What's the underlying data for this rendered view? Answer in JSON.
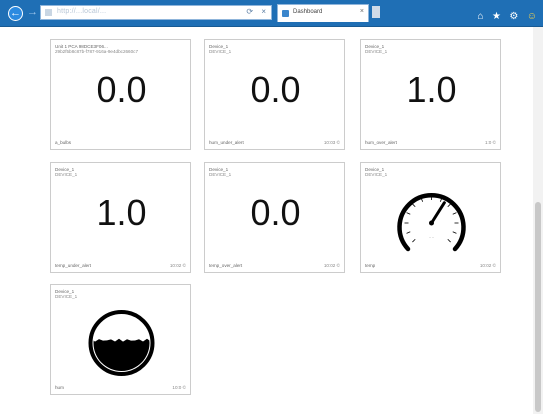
{
  "browser": {
    "url": "http://...local/...",
    "tab_label": "Dashboard",
    "tab_close": "×",
    "back": "←",
    "forward": "→",
    "tools": [
      "⌂",
      "★",
      "⚙",
      "☺"
    ]
  },
  "tiles": [
    {
      "title": "Unit 1 PCA 98DCE3F06...",
      "subtitle": "29b2f5b8c87b-f787-916a-9e4dbc2660c7",
      "value": "0.0",
      "footer": "a_bulbs",
      "time": ""
    },
    {
      "title": "Device_1",
      "subtitle": "DEVICE_1",
      "value": "0.0",
      "footer": "hum_under_alert",
      "time": "10:03 ©"
    },
    {
      "title": "Device_1",
      "subtitle": "DEVICE_1",
      "value": "1.0",
      "footer": "hum_over_alert",
      "time": "1:0 ©"
    },
    {
      "title": "Device_1",
      "subtitle": "DEVICE_1",
      "value": "1.0",
      "footer": "temp_under_alert",
      "time": "10:02 ©"
    },
    {
      "title": "Device_1",
      "subtitle": "DEVICE_1",
      "value": "0.0",
      "footer": "temp_over_alert",
      "time": "10:02 ©"
    },
    {
      "title": "Device_1",
      "subtitle": "DEVICE_1",
      "value": "",
      "footer": "temp",
      "time": "10:02 ©",
      "gauge_fraction": 0.62
    },
    {
      "title": "Device_1",
      "subtitle": "DEVICE_1",
      "value": "",
      "footer": "hum",
      "time": "10:0 ©",
      "tank_fraction": 0.55
    }
  ]
}
